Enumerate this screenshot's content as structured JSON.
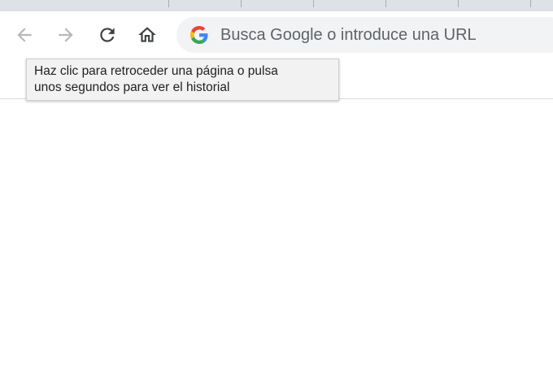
{
  "toolbar": {
    "back_icon": "arrow-left-icon",
    "forward_icon": "arrow-right-icon",
    "reload_icon": "reload-icon",
    "home_icon": "home-icon"
  },
  "omnibox": {
    "icon": "google-g-icon",
    "placeholder": "Busca Google o introduce una URL"
  },
  "tooltip": {
    "line1": "Haz clic para retroceder una página o pulsa",
    "line2": "unos segundos para ver el historial"
  },
  "colors": {
    "tabstrip": "#dee1e6",
    "omnibox_bg": "#f1f3f4",
    "icon_disabled": "#b6b9bd",
    "icon_active": "#3c4043",
    "tooltip_bg": "#f2f2f2"
  }
}
